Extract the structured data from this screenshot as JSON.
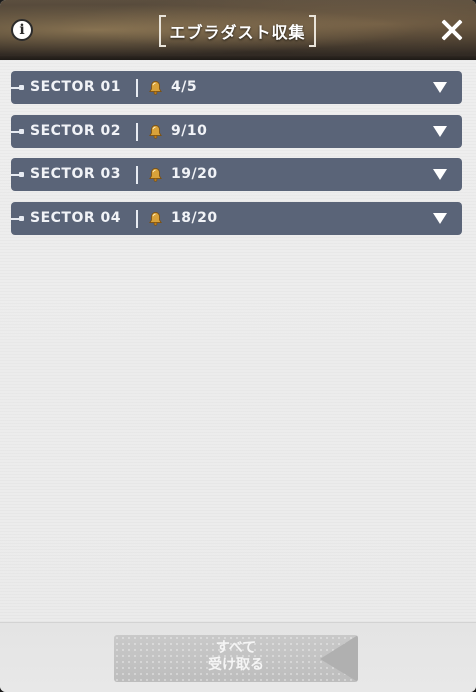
{
  "header": {
    "title": "エブラダスト収集",
    "info_icon": "info-icon",
    "close_icon": "close-icon"
  },
  "sectors": [
    {
      "name": "SECTOR 01",
      "collected": "4/5",
      "icon": "bell-resource-icon"
    },
    {
      "name": "SECTOR 02",
      "collected": "9/10",
      "icon": "bell-resource-icon"
    },
    {
      "name": "SECTOR 03",
      "collected": "19/20",
      "icon": "bell-resource-icon"
    },
    {
      "name": "SECTOR 04",
      "collected": "18/20",
      "icon": "bell-resource-icon"
    }
  ],
  "footer": {
    "claim_all_line1": "すべて",
    "claim_all_line2": "受け取る"
  },
  "colors": {
    "sector_bar": "#5a6478",
    "button_disabled": "#c4c4c4",
    "icon_gold": "#d9a23a"
  }
}
